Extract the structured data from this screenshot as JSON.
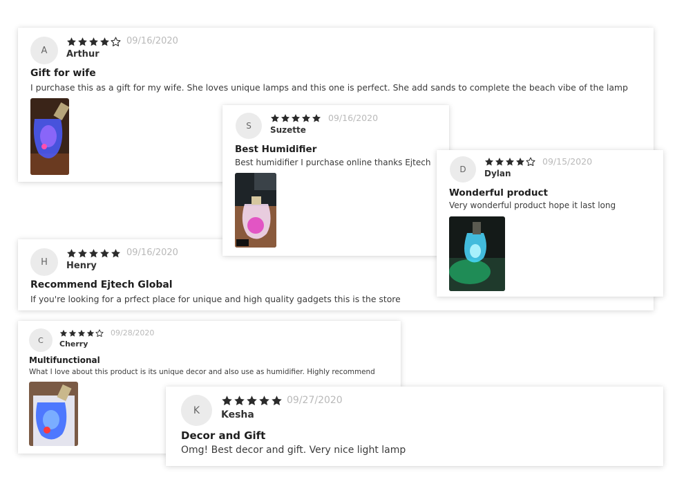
{
  "colors": {
    "star": "#2b2b2b",
    "date": "#b9b9b9",
    "avatar_bg": "#ebebeb"
  },
  "reviews": [
    {
      "initial": "A",
      "rating": 4,
      "date": "09/16/2020",
      "name": "Arthur",
      "title": "Gift for wife",
      "text": "I purchase this as a gift for my wife. She loves unique lamps and this one is perfect. She add sands to complete the beach vibe of the lamp",
      "photo": "lamp-blue-photo"
    },
    {
      "initial": "H",
      "rating": 5,
      "date": "09/16/2020",
      "name": "Henry",
      "title": "Recommend Ejtech Global",
      "text": "If you're looking for a prfect place for unique and high quality gadgets this is the store"
    },
    {
      "initial": "S",
      "rating": 5,
      "date": "09/16/2020",
      "name": "Suzette",
      "title": "Best Humidifier",
      "text": "Best humidifier I purchase online thanks Ejtech",
      "photo": "lamp-pink-photo"
    },
    {
      "initial": "D",
      "rating": 4,
      "date": "09/15/2020",
      "name": "Dylan",
      "title": "Wonderful product",
      "text": "Very wonderful product hope it last long",
      "photo": "lamp-green-photo"
    },
    {
      "initial": "C",
      "rating": 4,
      "date": "09/28/2020",
      "name": "Cherry",
      "title": "Multifunctional",
      "text": "What I love about this product is its unique decor and also use as humidifier. Highly recommend",
      "photo": "lamp-blue-white-photo"
    },
    {
      "initial": "K",
      "rating": 5,
      "date": "09/27/2020",
      "name": "Kesha",
      "title": "Decor and Gift",
      "text": "Omg! Best decor and gift. Very nice light lamp"
    }
  ]
}
